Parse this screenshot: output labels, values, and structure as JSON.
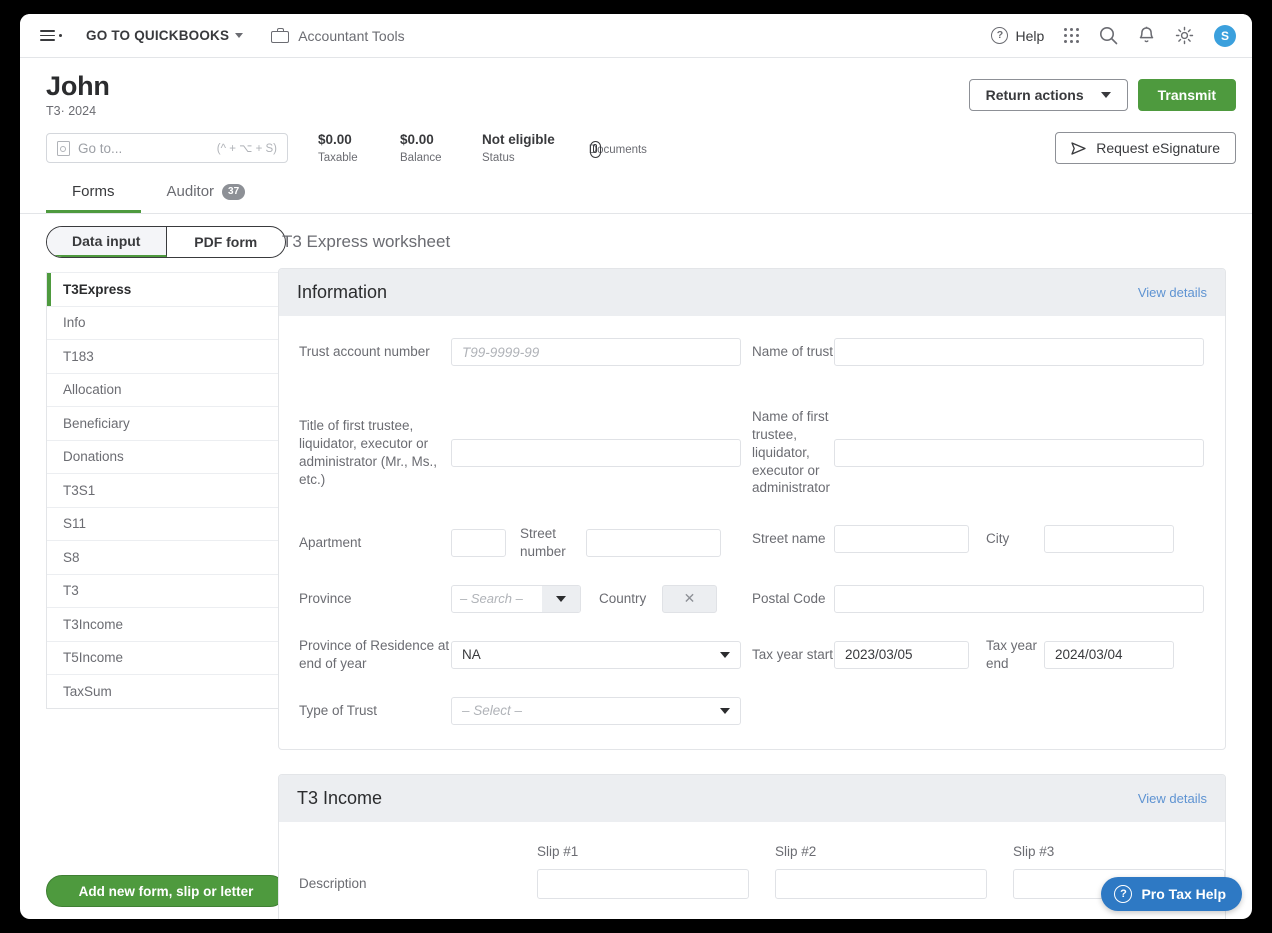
{
  "topbar": {
    "menu_icon": "hamburger-icon",
    "quickbooks_link": "GO TO QUICKBOOKS",
    "accountant_tools": "Accountant Tools",
    "help": "Help",
    "grid_icon": "apps-grid-icon",
    "search_icon": "search-icon",
    "bell_icon": "notifications-bell-icon",
    "gear_icon": "settings-gear-icon",
    "avatar_initial": "S",
    "avatar_color": "#3ba0dd"
  },
  "header": {
    "client_name": "John",
    "subtitle": "T3· 2024",
    "return_actions": "Return actions",
    "transmit": "Transmit",
    "transmit_color": "#4e9a3e"
  },
  "summary": {
    "goto_placeholder": "Go to...",
    "goto_shortcut": "(^ + ⌥ + S)",
    "stats": [
      {
        "value": "$0.00",
        "label": "Taxable"
      },
      {
        "value": "$0.00",
        "label": "Balance"
      },
      {
        "value": "Not eligible",
        "label": "Status"
      }
    ],
    "documents_label": "Documents",
    "documents_icon": "paperclip-icon",
    "request_esignature": "Request eSignature",
    "esign_icon": "send-plane-icon"
  },
  "tabs": [
    {
      "label": "Forms",
      "badge": "",
      "active": true
    },
    {
      "label": "Auditor",
      "badge": "37",
      "active": false
    }
  ],
  "left_panel": {
    "segmented": [
      {
        "label": "Data input",
        "selected": true
      },
      {
        "label": "PDF form",
        "selected": false
      }
    ],
    "forms": [
      {
        "label": "T3Express",
        "selected": true
      },
      {
        "label": "Info",
        "selected": false
      },
      {
        "label": "T183",
        "selected": false
      },
      {
        "label": "Allocation",
        "selected": false
      },
      {
        "label": "Beneficiary",
        "selected": false
      },
      {
        "label": "Donations",
        "selected": false
      },
      {
        "label": "T3S1",
        "selected": false
      },
      {
        "label": "S11",
        "selected": false
      },
      {
        "label": "S8",
        "selected": false
      },
      {
        "label": "T3",
        "selected": false
      },
      {
        "label": "T3Income",
        "selected": false
      },
      {
        "label": "T5Income",
        "selected": false
      },
      {
        "label": "TaxSum",
        "selected": false
      }
    ],
    "add_button": "Add new form, slip or letter"
  },
  "worksheet": {
    "title": "T3 Express worksheet",
    "information": {
      "heading": "Information",
      "view_details": "View details",
      "trust_account_number": {
        "label": "Trust account number",
        "placeholder": "T99-9999-99",
        "value": ""
      },
      "name_of_trust": {
        "label": "Name of trust",
        "value": ""
      },
      "title_first_trustee": {
        "label": "Title of first trustee, liquidator, executor or administrator (Mr., Ms., etc.)",
        "value": ""
      },
      "name_first_trustee": {
        "label": "Name of first trustee, liquidator, executor or administrator",
        "value": ""
      },
      "apartment": {
        "label": "Apartment",
        "value": ""
      },
      "street_number": {
        "label": "Street number",
        "value": ""
      },
      "street_name": {
        "label": "Street name",
        "value": ""
      },
      "city": {
        "label": "City",
        "value": ""
      },
      "province": {
        "label": "Province",
        "placeholder": "– Search –",
        "value": ""
      },
      "country": {
        "label": "Country",
        "clear_icon": "clear-x-icon",
        "value": ""
      },
      "postal_code": {
        "label": "Postal Code",
        "value": ""
      },
      "province_residence": {
        "label": "Province of Residence at end of year",
        "value": "NA"
      },
      "tax_year_start": {
        "label": "Tax year start",
        "value": "2023/03/05"
      },
      "tax_year_end": {
        "label": "Tax year end",
        "value": "2024/03/04"
      },
      "type_of_trust": {
        "label": "Type of Trust",
        "placeholder": "– Select –",
        "value": ""
      }
    },
    "t3_income": {
      "heading": "T3 Income",
      "view_details": "View details",
      "slips": [
        "Slip #1",
        "Slip #2",
        "Slip #3"
      ],
      "description_label": "Description"
    }
  },
  "pro_tax_help": {
    "label": "Pro Tax Help",
    "icon": "question-circle-icon",
    "color": "#2e79c4"
  }
}
